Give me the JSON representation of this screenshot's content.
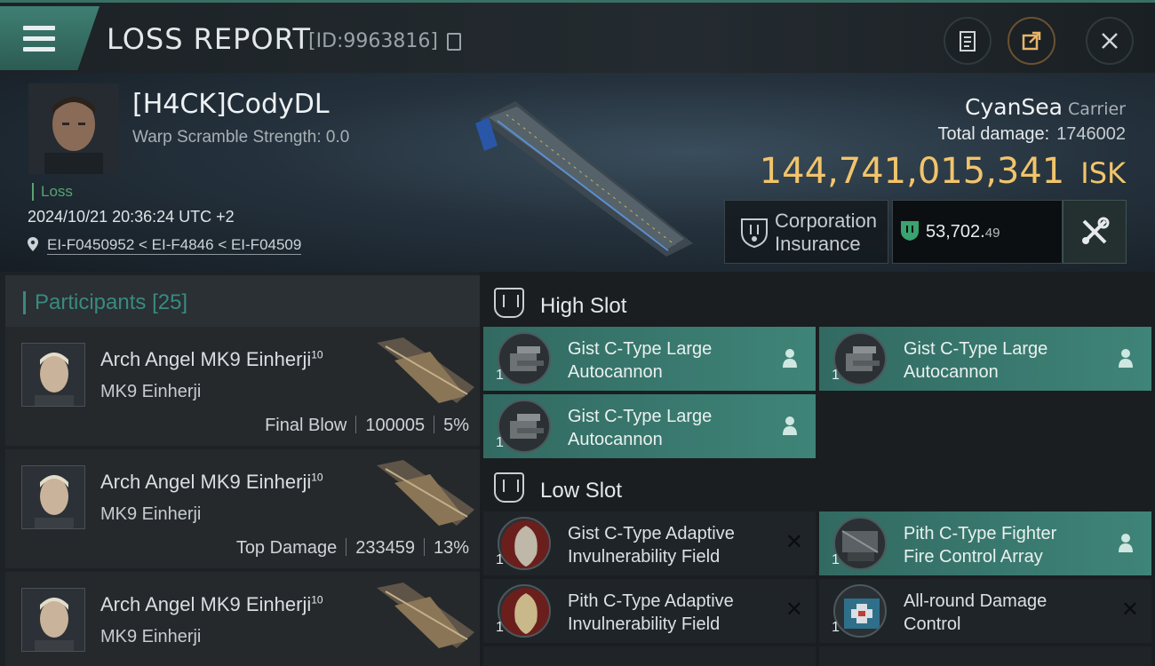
{
  "header": {
    "title": "LOSS REPORT",
    "report_id": "[ID:9963816]"
  },
  "victim": {
    "pilot_name": "[H4CK]CodyDL",
    "warp_scramble": "Warp Scramble Strength: 0.0",
    "status": "Loss",
    "timestamp": "2024/10/21 20:36:24 UTC +2",
    "location": "EI-F0450952 < EI-F4846 < EI-F04509",
    "ship_name": "CyanSea",
    "ship_class": "Carrier",
    "total_damage_label": "Total damage:",
    "total_damage": "1746002",
    "isk_value": "144,741,015,341",
    "isk_unit": "ISK",
    "insurance_label_1": "Corporation",
    "insurance_label_2": "Insurance",
    "payout_main": "53,702.",
    "payout_decimals": "49"
  },
  "participants": {
    "label": "Participants",
    "count": "[25]",
    "rows": [
      {
        "name": "Arch Angel MK9 Einherji",
        "level": "10",
        "ship": "MK9 Einherji",
        "tag": "Final Blow",
        "damage": "100005",
        "percent": "5%"
      },
      {
        "name": "Arch Angel MK9 Einherji",
        "level": "10",
        "ship": "MK9 Einherji",
        "tag": "Top Damage",
        "damage": "233459",
        "percent": "13%"
      },
      {
        "name": "Arch Angel MK9 Einherji",
        "level": "10",
        "ship": "MK9 Einherji"
      }
    ]
  },
  "slots": {
    "high_label": "High Slot",
    "low_label": "Low Slot",
    "high": [
      {
        "line1": "Gist C-Type Large",
        "line2": "Autocannon",
        "qty": "1"
      },
      {
        "line1": "Gist C-Type Large",
        "line2": "Autocannon",
        "qty": "1"
      },
      {
        "line1": "Gist C-Type Large",
        "line2": "Autocannon",
        "qty": "1"
      }
    ],
    "low": [
      {
        "line1": "Gist C-Type Adaptive",
        "line2": "Invulnerability Field",
        "qty": "1"
      },
      {
        "line1": "Pith C-Type Fighter",
        "line2": "Fire Control Array",
        "qty": "1"
      },
      {
        "line1": "Pith C-Type Adaptive",
        "line2": "Invulnerability Field",
        "qty": "1"
      },
      {
        "line1": "All-round Damage",
        "line2": "Control",
        "qty": "1"
      }
    ]
  },
  "colors": {
    "accent_teal": "#3f8478",
    "isk_gold": "#f2c46b",
    "loss_green": "#58a46f"
  },
  "icons": [
    "menu-icon",
    "copy-icon",
    "clipboard-icon",
    "share-icon",
    "close-icon",
    "location-pin-icon",
    "shield-icon",
    "wrench-icon",
    "person-icon",
    "slot-icon"
  ]
}
